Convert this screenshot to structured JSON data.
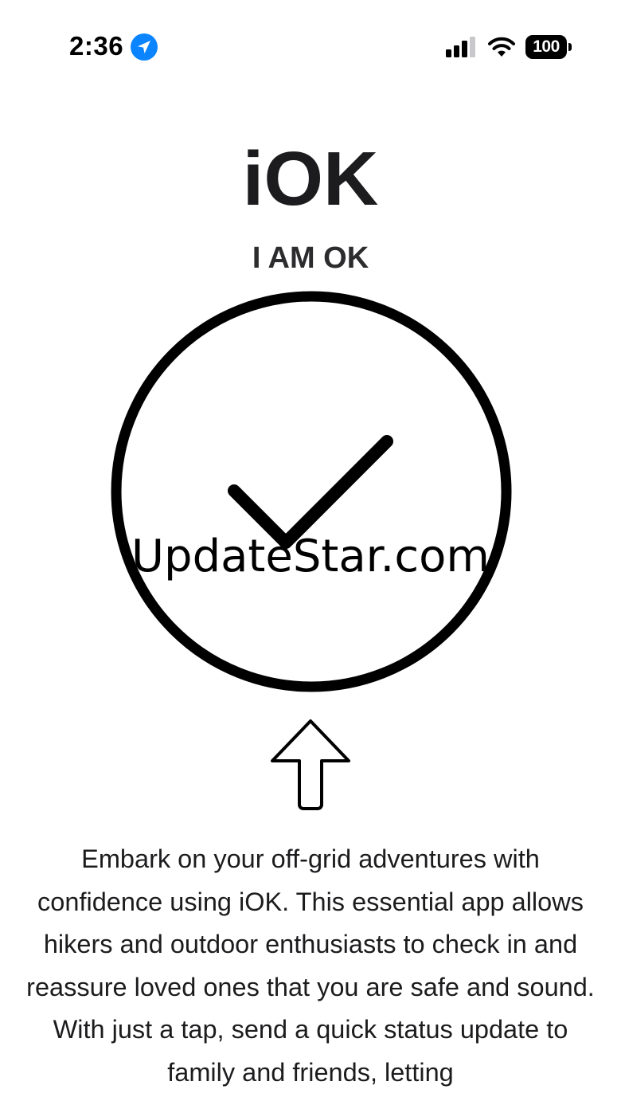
{
  "status_bar": {
    "time": "2:36",
    "battery_level": "100",
    "icons": [
      "location-arrow-icon",
      "cellular-signal-icon",
      "wifi-icon",
      "battery-icon"
    ]
  },
  "app": {
    "title": "iOK",
    "subtitle": "I AM OK",
    "check_in_button_icon": "checkmark-circle-icon",
    "hint_icon": "up-arrow-icon"
  },
  "watermark": "UpdateStar.com",
  "description": "Embark on your off-grid adventures with confidence using iOK. This essential app allows hikers and outdoor enthusiasts to check in and reassure loved ones that you are safe and sound. With just a tap, send a quick status update to family and friends, letting",
  "colors": {
    "location_blue": "#0a84ff",
    "text": "#1c1c1e",
    "stroke": "#000000",
    "background": "#ffffff"
  }
}
